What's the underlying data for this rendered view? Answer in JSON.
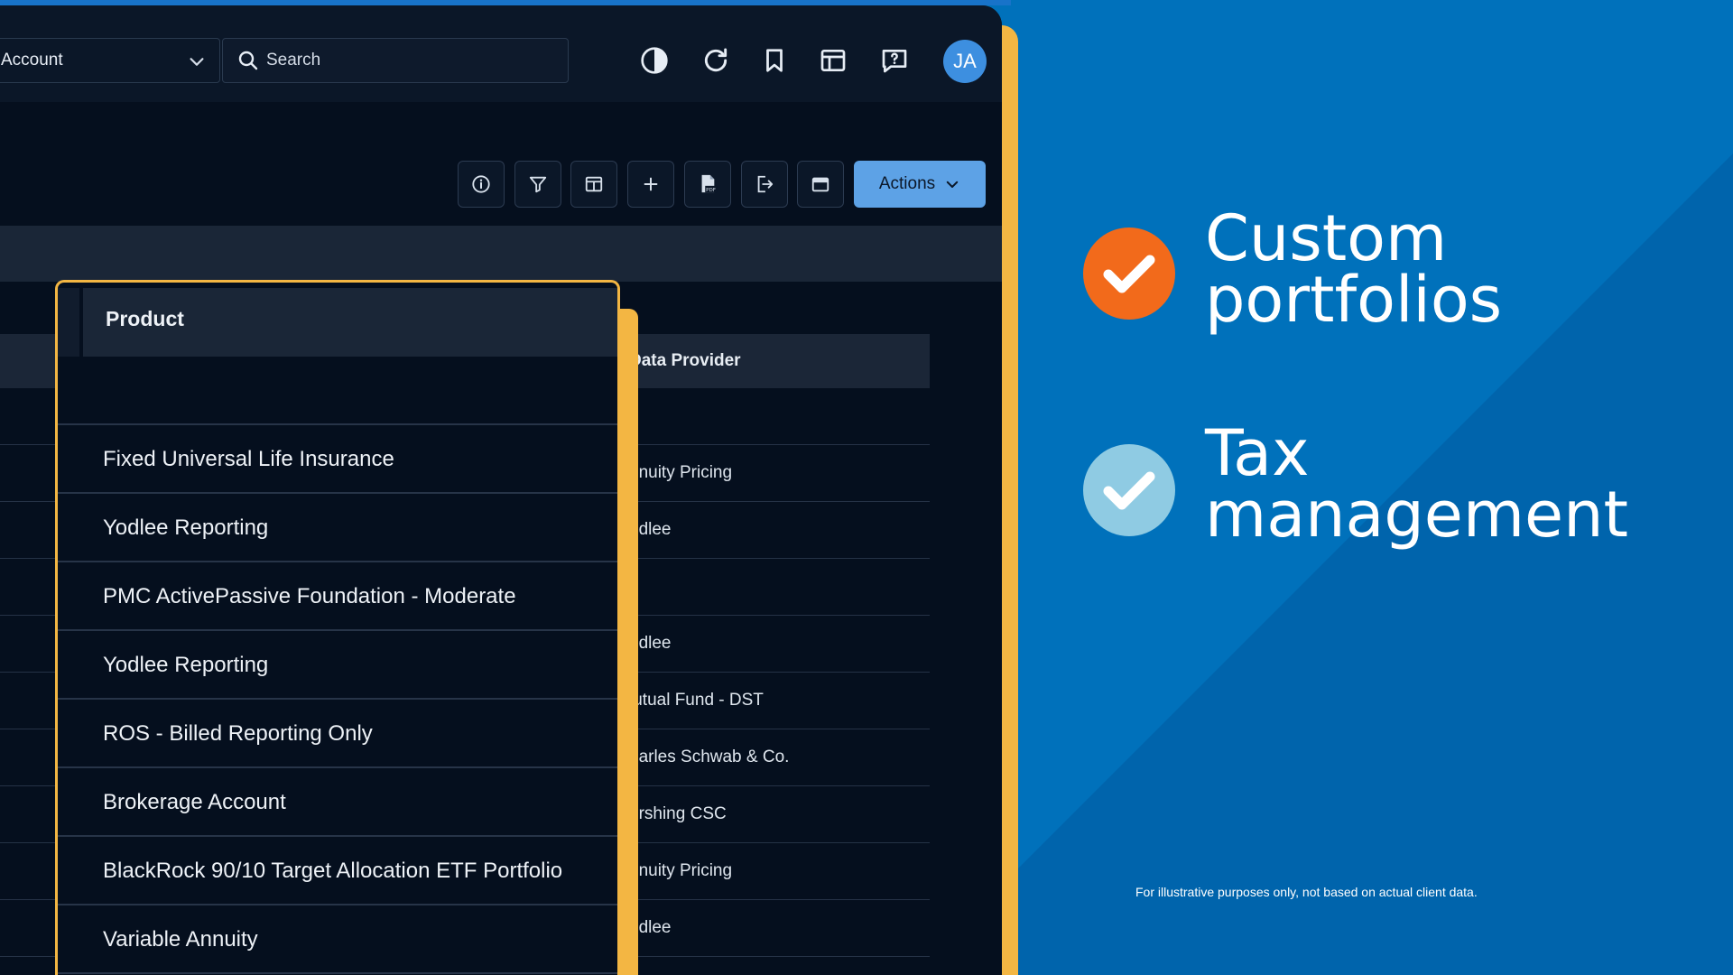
{
  "header": {
    "account_label": "Account",
    "search_placeholder": "Search",
    "avatar_initials": "JA"
  },
  "toolbar": {
    "actions_label": "Actions"
  },
  "background_table": {
    "column_header": "Data Provider",
    "rows": [
      "",
      "nnuity Pricing",
      "odlee",
      "",
      "odlee",
      "lutual Fund - DST",
      "harles Schwab & Co.",
      "ershing CSC",
      "nnuity Pricing",
      "odlee"
    ]
  },
  "column_overlay": {
    "header": "Product",
    "rows": [
      "",
      "Fixed Universal Life Insurance",
      "Yodlee Reporting",
      "PMC ActivePassive Foundation - Moderate",
      "Yodlee Reporting",
      "ROS - Billed Reporting Only",
      "Brokerage Account",
      "BlackRock 90/10 Target Allocation ETF Portfolio",
      "Variable Annuity"
    ]
  },
  "promo": {
    "feature1_line1": "Custom",
    "feature1_line2": "portfolios",
    "feature2_line1": "Tax",
    "feature2_line2": "management",
    "disclaimer": "For illustrative purposes only, not based on actual client data.",
    "check1_color": "#f26a1b",
    "check2_color": "#8fcbe3"
  },
  "icons": [
    "contrast-icon",
    "refresh-icon",
    "bookmark-icon",
    "layout-icon",
    "help-chat-icon",
    "info-icon",
    "filter-icon",
    "columns-icon",
    "plus-icon",
    "pdf-icon",
    "export-icon",
    "calendar-icon",
    "chevron-down-icon",
    "search-icon",
    "check-icon"
  ]
}
